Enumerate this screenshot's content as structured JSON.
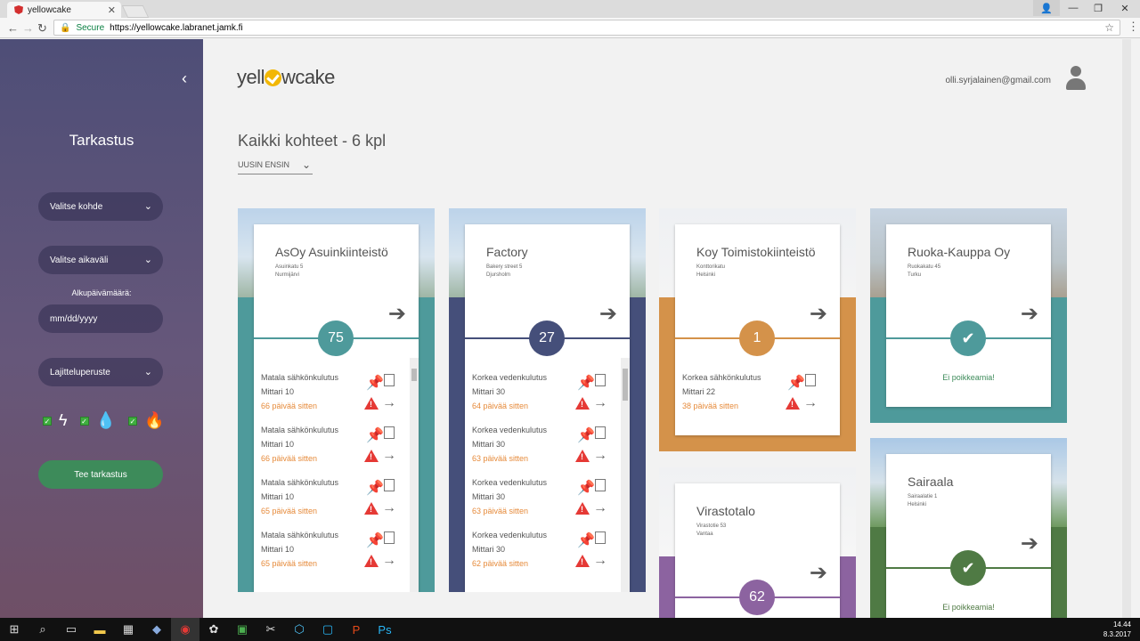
{
  "browser": {
    "tab_title": "yellowcake",
    "secure_label": "Secure",
    "url": "https://yellowcake.labranet.jamk.fi"
  },
  "sidebar": {
    "title": "Tarkastus",
    "select_target": "Valitse kohde",
    "select_period": "Valitse aikaväli",
    "start_date_label": "Alkupäivämäärä:",
    "date_placeholder": "mm/dd/yyyy",
    "sort_criteria": "Lajitteluperuste",
    "submit": "Tee tarkastus"
  },
  "header": {
    "logo_prefix": "yell",
    "logo_suffix": "wcake",
    "user_email": "olli.syrjalainen@gmail.com"
  },
  "page": {
    "title": "Kaikki kohteet - 6 kpl",
    "sort_value": "UUSIN ENSIN"
  },
  "cards": [
    {
      "name": "AsOy Asuinkiinteistö",
      "street": "Asuinkatu 5",
      "city": "Nurmijärvi",
      "count": "75",
      "color": "#4e9a9b",
      "items": [
        {
          "title": "Matala sähkönkulutus",
          "meter": "Mittari 10",
          "days": "66 päivää sitten"
        },
        {
          "title": "Matala sähkönkulutus",
          "meter": "Mittari 10",
          "days": "66 päivää sitten"
        },
        {
          "title": "Matala sähkönkulutus",
          "meter": "Mittari 10",
          "days": "65 päivää sitten"
        },
        {
          "title": "Matala sähkönkulutus",
          "meter": "Mittari 10",
          "days": "65 päivää sitten"
        }
      ]
    },
    {
      "name": "Factory",
      "street": "Bakery street 5",
      "city": "Djursholm",
      "count": "27",
      "color": "#454f7a",
      "items": [
        {
          "title": "Korkea vedenkulutus",
          "meter": "Mittari 30",
          "days": "64 päivää sitten"
        },
        {
          "title": "Korkea vedenkulutus",
          "meter": "Mittari 30",
          "days": "63 päivää sitten"
        },
        {
          "title": "Korkea vedenkulutus",
          "meter": "Mittari 30",
          "days": "63 päivää sitten"
        },
        {
          "title": "Korkea vedenkulutus",
          "meter": "Mittari 30",
          "days": "62 päivää sitten"
        }
      ]
    },
    {
      "name": "Koy Toimistokiinteistö",
      "street": "Konttorikatu",
      "city": "Helsinki",
      "count": "1",
      "color": "#d4924a",
      "items": [
        {
          "title": "Korkea sähkönkulutus",
          "meter": "Mittari 22",
          "days": "38 päivää sitten"
        }
      ]
    },
    {
      "name": "Ruoka-Kauppa Oy",
      "street": "Ruokakatu 45",
      "city": "Turku",
      "color": "#4e9a9b",
      "ok_message": "Ei poikkeamia!"
    },
    {
      "name": "Virastotalo",
      "street": "Virastotie 53",
      "city": "Vantaa",
      "count": "62",
      "color": "#8c63a0"
    },
    {
      "name": "Sairaala",
      "street": "Sairaalatie 1",
      "city": "Helsinki",
      "color": "#4f7a44",
      "ok_message": "Ei poikkeamia!"
    }
  ],
  "taskbar": {
    "time": "14.44",
    "date": "8.3.2017"
  },
  "icons": [
    "angular-icon",
    "tab-close-icon",
    "back-icon",
    "forward-icon",
    "reload-icon",
    "lock-icon",
    "star-icon",
    "menu-icon",
    "chevron-left-icon",
    "chevron-down-icon",
    "electricity-icon",
    "water-icon",
    "heat-icon",
    "arrow-right-icon",
    "pin-icon",
    "document-icon",
    "warning-icon",
    "checkmark-icon",
    "user-icon",
    "windows-start-icon",
    "search-icon",
    "task-view-icon"
  ]
}
